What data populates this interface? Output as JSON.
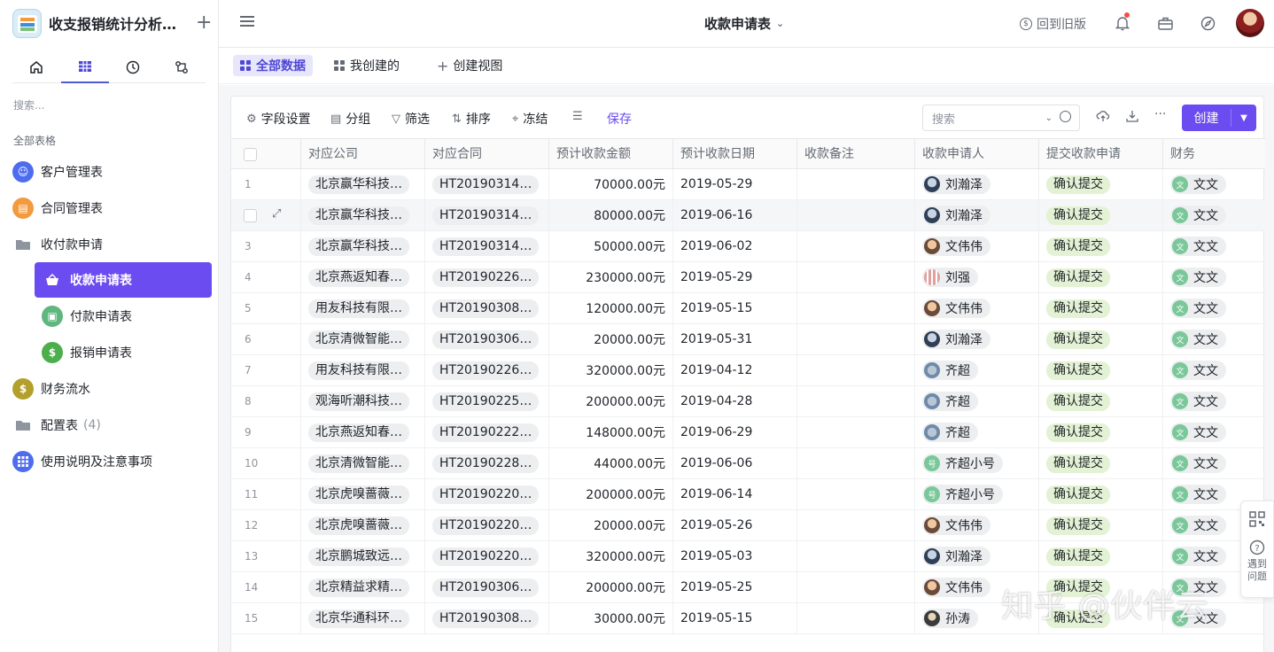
{
  "app": {
    "title": "收支报销统计分析…"
  },
  "sidebar": {
    "search_placeholder": "搜索...",
    "section_label": "全部表格",
    "items": [
      {
        "label": "客户管理表",
        "icon": "users-icon",
        "color": "#4e6cf0"
      },
      {
        "label": "合同管理表",
        "icon": "document-icon",
        "color": "#f29a3d"
      },
      {
        "label": "收付款申请",
        "icon": "folder-icon"
      },
      {
        "label": "收款申请表",
        "icon": "basket-icon"
      },
      {
        "label": "付款申请表",
        "icon": "wallet-icon",
        "color": "#5fb67e"
      },
      {
        "label": "报销申请表",
        "icon": "dollar-icon",
        "color": "#4cae4c"
      },
      {
        "label": "财务流水",
        "icon": "dollar-icon",
        "color": "#b3a02c"
      },
      {
        "label": "配置表",
        "count": "(4)",
        "icon": "folder-icon"
      },
      {
        "label": "使用说明及注意事项",
        "icon": "grid-icon",
        "color": "#4e6cf0"
      }
    ]
  },
  "header": {
    "title": "收款申请表",
    "back_old": "回到旧版"
  },
  "views": {
    "tabs": [
      {
        "label": "全部数据"
      },
      {
        "label": "我创建的"
      },
      {
        "label": "创建视图"
      }
    ]
  },
  "toolbar": {
    "field_settings": "字段设置",
    "group": "分组",
    "filter": "筛选",
    "sort": "排序",
    "freeze": "冻结",
    "save": "保存",
    "search_placeholder": "搜索",
    "create": "创建"
  },
  "table": {
    "columns": [
      "对应公司",
      "对应合同",
      "预计收款金额",
      "预计收款日期",
      "收款备注",
      "收款申请人",
      "提交收款申请",
      "财务"
    ],
    "rows": [
      {
        "num": "1",
        "company": "北京赢华科技…",
        "contract": "HT20190314…",
        "amount": "70000.00元",
        "date": "2019-05-29",
        "applicant": "刘瀚泽",
        "status": "确认提交",
        "finance": "文文",
        "fin_initial": "文"
      },
      {
        "num": "2",
        "company": "北京赢华科技…",
        "contract": "HT20190314…",
        "amount": "80000.00元",
        "date": "2019-06-16",
        "applicant": "刘瀚泽",
        "status": "确认提交",
        "finance": "文文",
        "fin_initial": "文"
      },
      {
        "num": "3",
        "company": "北京赢华科技…",
        "contract": "HT20190314…",
        "amount": "50000.00元",
        "date": "2019-06-02",
        "applicant": "文伟伟",
        "status": "确认提交",
        "finance": "文文",
        "fin_initial": "文"
      },
      {
        "num": "4",
        "company": "北京燕返知春…",
        "contract": "HT20190226…",
        "amount": "230000.00元",
        "date": "2019-05-29",
        "applicant": "刘强",
        "status": "确认提交",
        "finance": "文文",
        "fin_initial": "文"
      },
      {
        "num": "5",
        "company": "用友科技有限…",
        "contract": "HT20190308…",
        "amount": "120000.00元",
        "date": "2019-05-15",
        "applicant": "文伟伟",
        "status": "确认提交",
        "finance": "文文",
        "fin_initial": "文"
      },
      {
        "num": "6",
        "company": "北京清微智能…",
        "contract": "HT20190306…",
        "amount": "20000.00元",
        "date": "2019-05-31",
        "applicant": "刘瀚泽",
        "status": "确认提交",
        "finance": "文文",
        "fin_initial": "文"
      },
      {
        "num": "7",
        "company": "用友科技有限…",
        "contract": "HT20190226…",
        "amount": "320000.00元",
        "date": "2019-04-12",
        "applicant": "齐超",
        "status": "确认提交",
        "finance": "文文",
        "fin_initial": "文"
      },
      {
        "num": "8",
        "company": "观海听潮科技…",
        "contract": "HT20190225…",
        "amount": "200000.00元",
        "date": "2019-04-28",
        "applicant": "齐超",
        "status": "确认提交",
        "finance": "文文",
        "fin_initial": "文"
      },
      {
        "num": "9",
        "company": "北京燕返知春…",
        "contract": "HT20190222…",
        "amount": "148000.00元",
        "date": "2019-06-29",
        "applicant": "齐超",
        "status": "确认提交",
        "finance": "文文",
        "fin_initial": "文"
      },
      {
        "num": "10",
        "company": "北京清微智能…",
        "contract": "HT20190228…",
        "amount": "44000.00元",
        "date": "2019-06-06",
        "applicant": "齐超小号",
        "applicant_initial": "号",
        "status": "确认提交",
        "finance": "文文",
        "fin_initial": "文"
      },
      {
        "num": "11",
        "company": "北京虎嗅蔷薇…",
        "contract": "HT20190220…",
        "amount": "200000.00元",
        "date": "2019-06-14",
        "applicant": "齐超小号",
        "applicant_initial": "号",
        "status": "确认提交",
        "finance": "文文",
        "fin_initial": "文"
      },
      {
        "num": "12",
        "company": "北京虎嗅蔷薇…",
        "contract": "HT20190220…",
        "amount": "20000.00元",
        "date": "2019-05-26",
        "applicant": "文伟伟",
        "status": "确认提交",
        "finance": "文文",
        "fin_initial": "文"
      },
      {
        "num": "13",
        "company": "北京鹏城致远…",
        "contract": "HT20190220…",
        "amount": "320000.00元",
        "date": "2019-05-03",
        "applicant": "刘瀚泽",
        "status": "确认提交",
        "finance": "文文",
        "fin_initial": "文"
      },
      {
        "num": "14",
        "company": "北京精益求精…",
        "contract": "HT20190306…",
        "amount": "200000.00元",
        "date": "2019-05-25",
        "applicant": "文伟伟",
        "status": "确认提交",
        "finance": "文文",
        "fin_initial": "文"
      },
      {
        "num": "15",
        "company": "北京华通科环…",
        "contract": "HT20190308…",
        "amount": "30000.00元",
        "date": "2019-05-15",
        "applicant": "孙涛",
        "status": "确认提交",
        "finance": "文文",
        "fin_initial": "文"
      }
    ]
  },
  "float_panel": {
    "help_label": "遇到问题"
  },
  "watermark": "知乎 @伙伴云",
  "colors": {
    "accent": "#6b4cf0",
    "status_bg": "#e3f2d4"
  }
}
